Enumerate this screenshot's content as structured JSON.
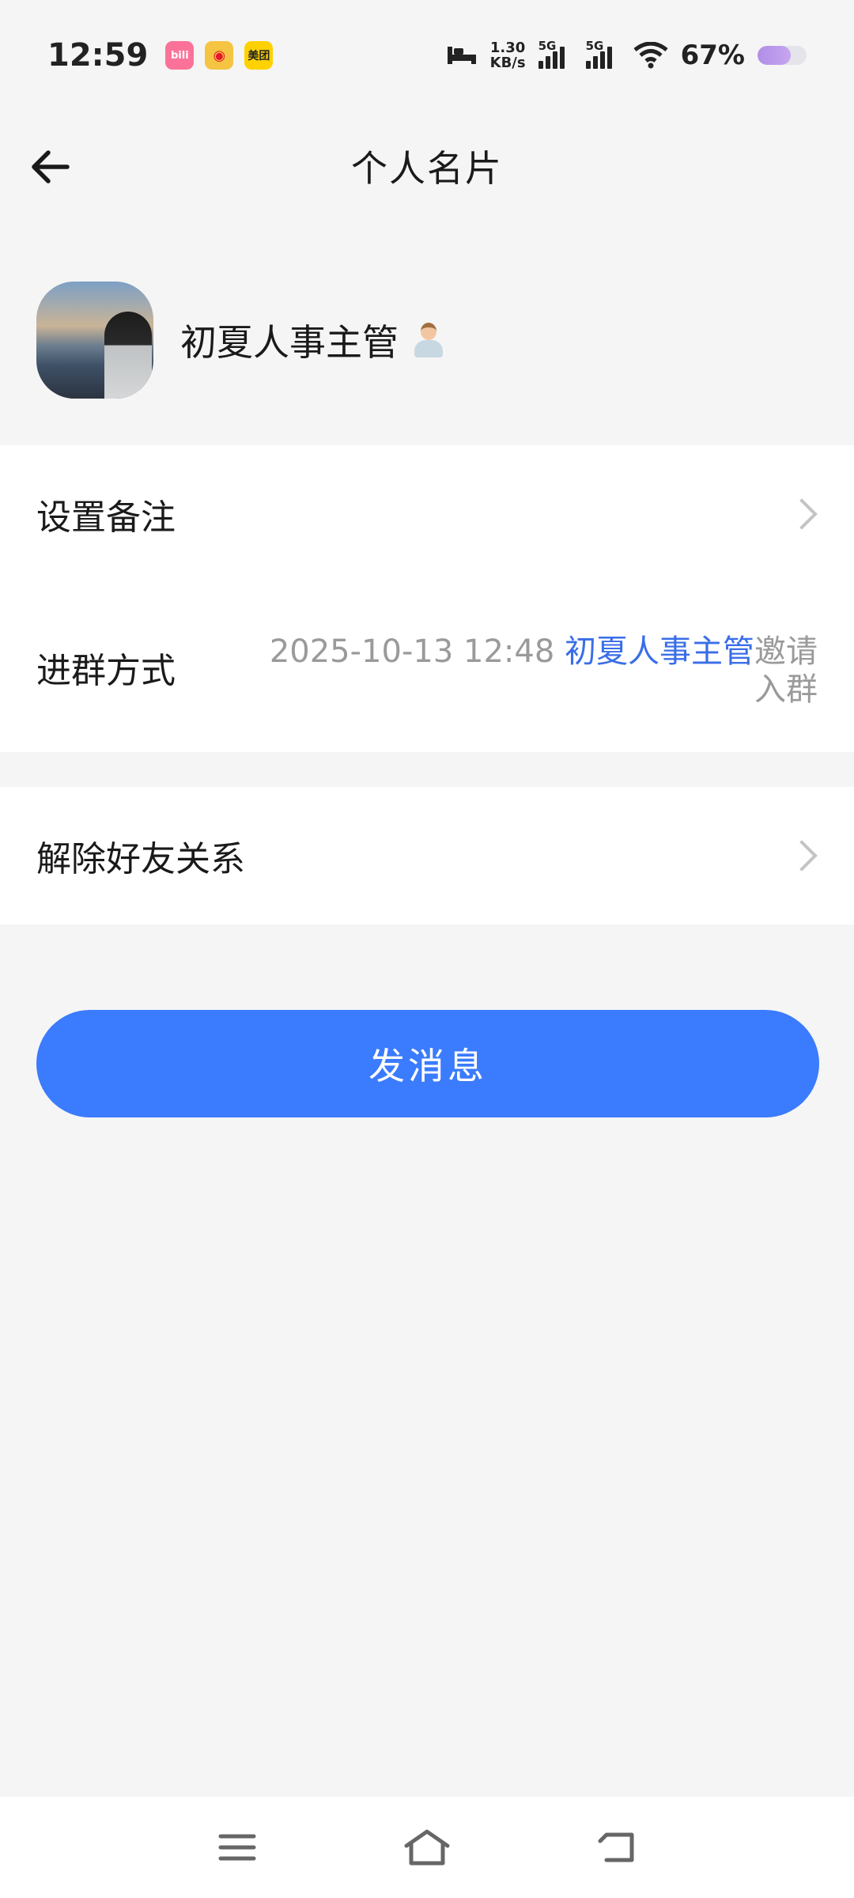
{
  "status_bar": {
    "time": "12:59",
    "apps": [
      "bilibili",
      "微博",
      "美团"
    ],
    "net_speed_value": "1.30",
    "net_speed_unit": "KB/s",
    "signal_1": "5G",
    "signal_2": "5G",
    "battery": "67%"
  },
  "header": {
    "title": "个人名片"
  },
  "profile": {
    "name": "初夏人事主管"
  },
  "rows": {
    "remark_label": "设置备注",
    "join_label": "进群方式",
    "join_time": "2025-10-13 12:48 ",
    "join_inviter": "初夏人事主管",
    "join_suffix": "邀请入群",
    "unfriend_label": "解除好友关系"
  },
  "actions": {
    "send_message": "发消息"
  },
  "colors": {
    "accent": "#3b7bfd",
    "link_blue": "#3a6ee8",
    "background": "#f5f5f5"
  },
  "icons": [
    "back-arrow-icon",
    "chevron-right-icon",
    "menu-icon",
    "home-icon",
    "back-icon"
  ]
}
